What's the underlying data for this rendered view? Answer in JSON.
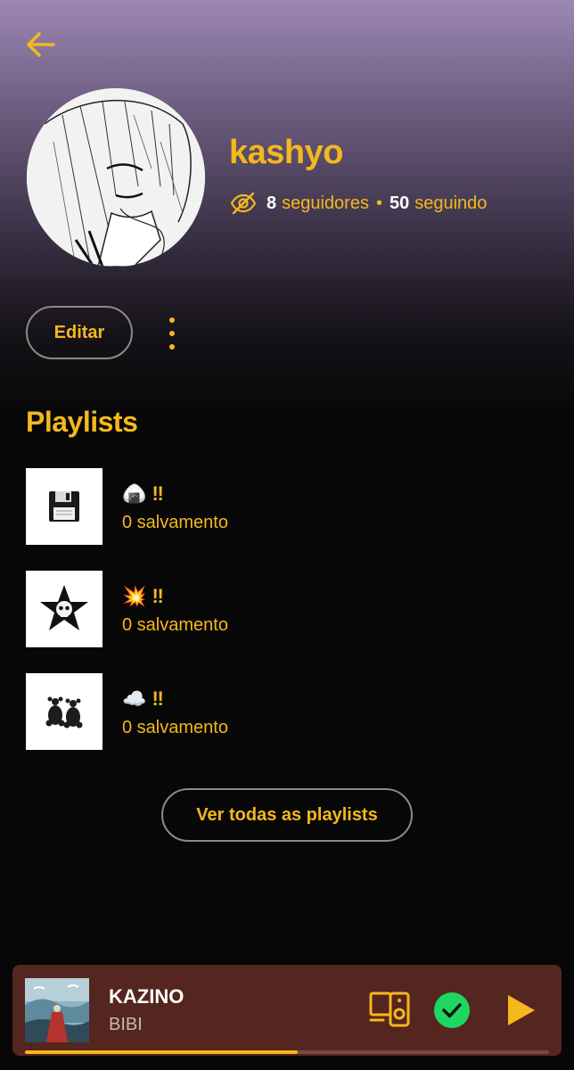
{
  "profile": {
    "username": "kashyo",
    "followers_count": "8",
    "followers_label": "seguidores",
    "following_count": "50",
    "following_label": "seguindo",
    "separator": "•",
    "edit_label": "Editar"
  },
  "playlists_section": {
    "title": "Playlists",
    "items": [
      {
        "name": "🍙 ‼",
        "saves": "0 salvamento",
        "thumb_icon": "floppy-disk"
      },
      {
        "name": "💥 ‼",
        "saves": "0 salvamento",
        "thumb_icon": "skull-star"
      },
      {
        "name": "☁️ ‼",
        "saves": "0 salvamento",
        "thumb_icon": "gummy-bears"
      }
    ],
    "see_all_label": "Ver todas as playlists"
  },
  "now_playing": {
    "title": "KAZINO",
    "artist": "BIBI",
    "progress": 0.52
  },
  "colors": {
    "accent": "#f5b81c",
    "player_bg": "#55261f",
    "saved_green": "#1ed760"
  }
}
